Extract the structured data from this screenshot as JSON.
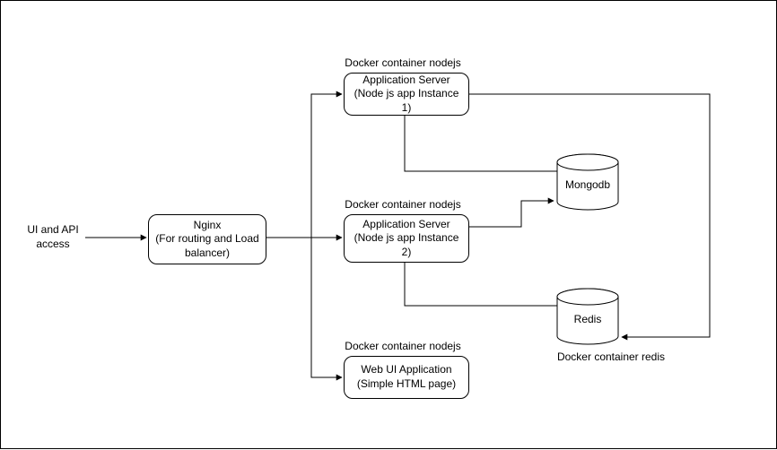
{
  "entry_label": "UI and API\naccess",
  "nginx": {
    "title": "Nginx",
    "sub": "(For routing and Load\nbalancer)",
    "caption": ""
  },
  "app1": {
    "caption": "Docker container nodejs",
    "title": "Application Server",
    "sub": "(Node js app Instance 1)"
  },
  "app2": {
    "caption": "Docker container nodejs",
    "title": "Application Server",
    "sub": "(Node js app Instance 2)"
  },
  "webui": {
    "caption": "Docker container nodejs",
    "title": "Web UI Application",
    "sub": "(Simple HTML page)"
  },
  "mongodb": {
    "label": "Mongodb"
  },
  "redis": {
    "label": "Redis",
    "caption": "Docker container redis"
  }
}
